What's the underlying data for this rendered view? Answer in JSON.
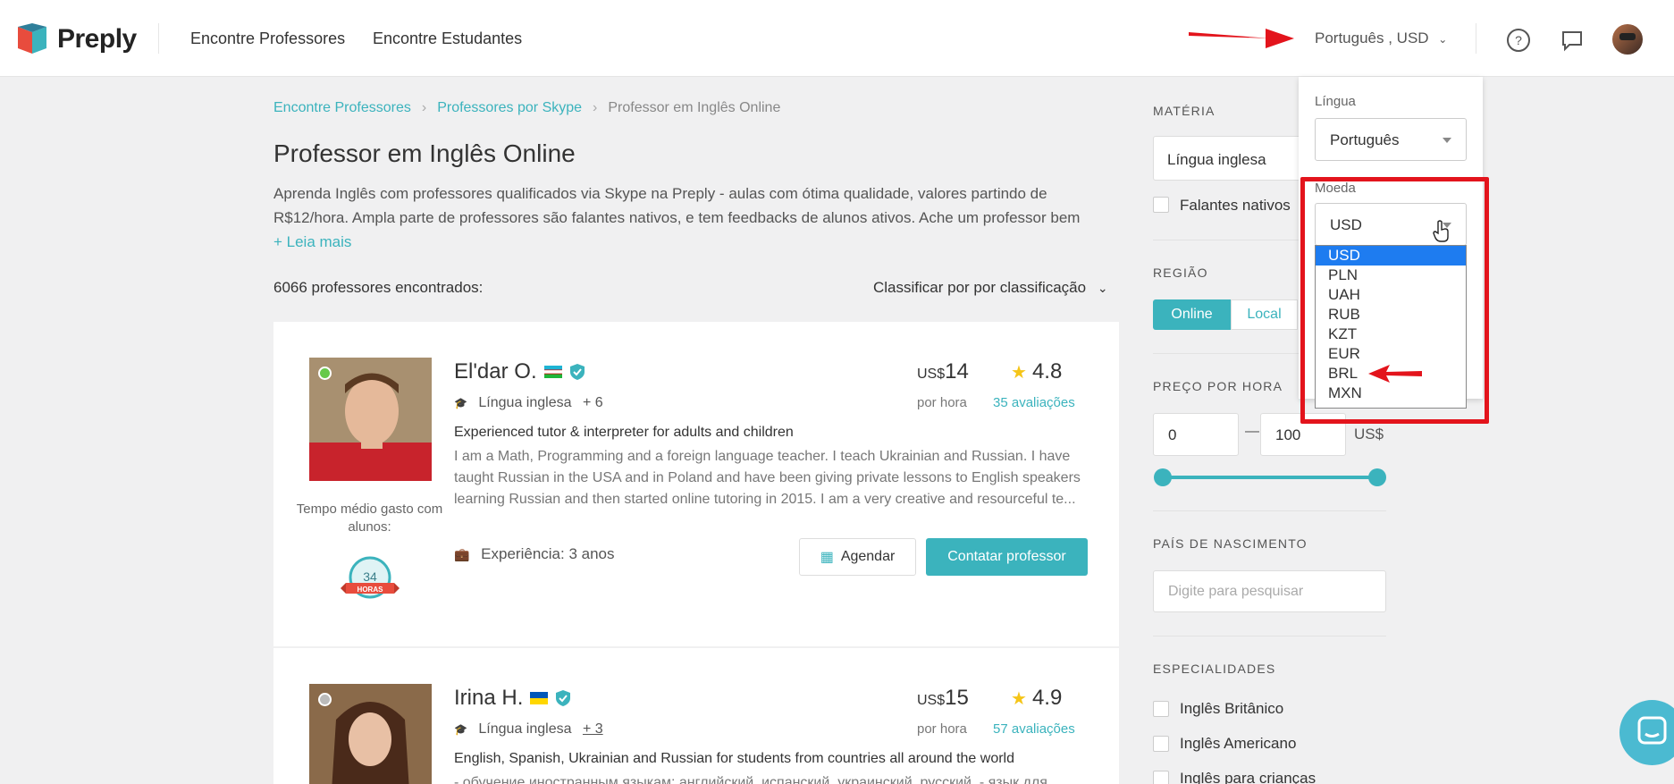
{
  "header": {
    "logo_text": "Preply",
    "nav": [
      "Encontre Professores",
      "Encontre Estudantes"
    ],
    "lang_currency": "Português , USD",
    "icons": [
      "help-circle-icon",
      "chat-bubble-icon",
      "user-avatar"
    ]
  },
  "breadcrumb": [
    "Encontre Professores",
    "Professores por Skype",
    "Professor em Inglês Online"
  ],
  "page": {
    "title": "Professor em Inglês Online",
    "description": "Aprenda Inglês com professores qualificados via Skype na Preply - aulas com ótima qualidade, valores partindo de R$12/hora. Ampla parte de professores são falantes nativos, e tem feedbacks de alunos ativos. Ache um professor bem",
    "read_more": "+ Leia mais",
    "count": "6066 professores encontrados:",
    "sort": "Classificar por por classificação"
  },
  "tutors": [
    {
      "name": "El'dar O.",
      "subject": "Língua inglesa",
      "more": "+ 6",
      "price_prefix": "US$",
      "price": "14",
      "per_hour": "por hora",
      "rating": "4.8",
      "reviews": "35 avaliações",
      "headline": "Experienced tutor & interpreter for adults and children",
      "bio": "I am a Math, Programming and a foreign language teacher. I teach Ukrainian and Russian. I have taught Russian in the USA and in Poland and have been giving private lessons to English speakers learning Russian and then started online tutoring in 2015. I am a very creative and resourceful te...",
      "avg_time": "Tempo médio gasto com alunos:",
      "badge_num": "34",
      "badge_txt": "HORAS",
      "experience": "Experiência: 3 anos",
      "schedule": "Agendar",
      "contact": "Contatar professor",
      "online_color": "#66c94a"
    },
    {
      "name": "Irina H.",
      "subject": "Língua inglesa",
      "more": "+ 3",
      "price_prefix": "US$",
      "price": "15",
      "per_hour": "por hora",
      "rating": "4.9",
      "reviews": "57 avaliações",
      "headline": "English, Spanish, Ukrainian and Russian for students from countries all around the world",
      "bio": "- обучение иностранным языкам: английский, испанский, украинский, русский. - язык для"
    }
  ],
  "sidebar": {
    "subject_label": "MATÉRIA",
    "subject_value": "Língua inglesa",
    "native_label": "Falantes nativos",
    "region_label": "REGIÃO",
    "region_online": "Online",
    "region_local": "Local",
    "price_label": "PREÇO POR HORA",
    "price_min": "0",
    "price_max": "100",
    "price_currency": "US$",
    "price_dash": "—",
    "birth_label": "PAÍS DE NASCIMENTO",
    "birth_placeholder": "Digite para pesquisar",
    "spec_label": "ESPECIALIDADES",
    "specialties": [
      "Inglês Britânico",
      "Inglês Americano",
      "Inglês para crianças"
    ]
  },
  "dropdown": {
    "lang_label": "Língua",
    "lang_value": "Português",
    "currency_label": "Moeda",
    "currency_value": "USD",
    "options": [
      "USD",
      "PLN",
      "UAH",
      "RUB",
      "KZT",
      "EUR",
      "BRL",
      "MXN"
    ]
  },
  "colors": {
    "accent": "#3bb3bd",
    "annotation_red": "#e3141c",
    "select_blue": "#1e7cf0"
  }
}
